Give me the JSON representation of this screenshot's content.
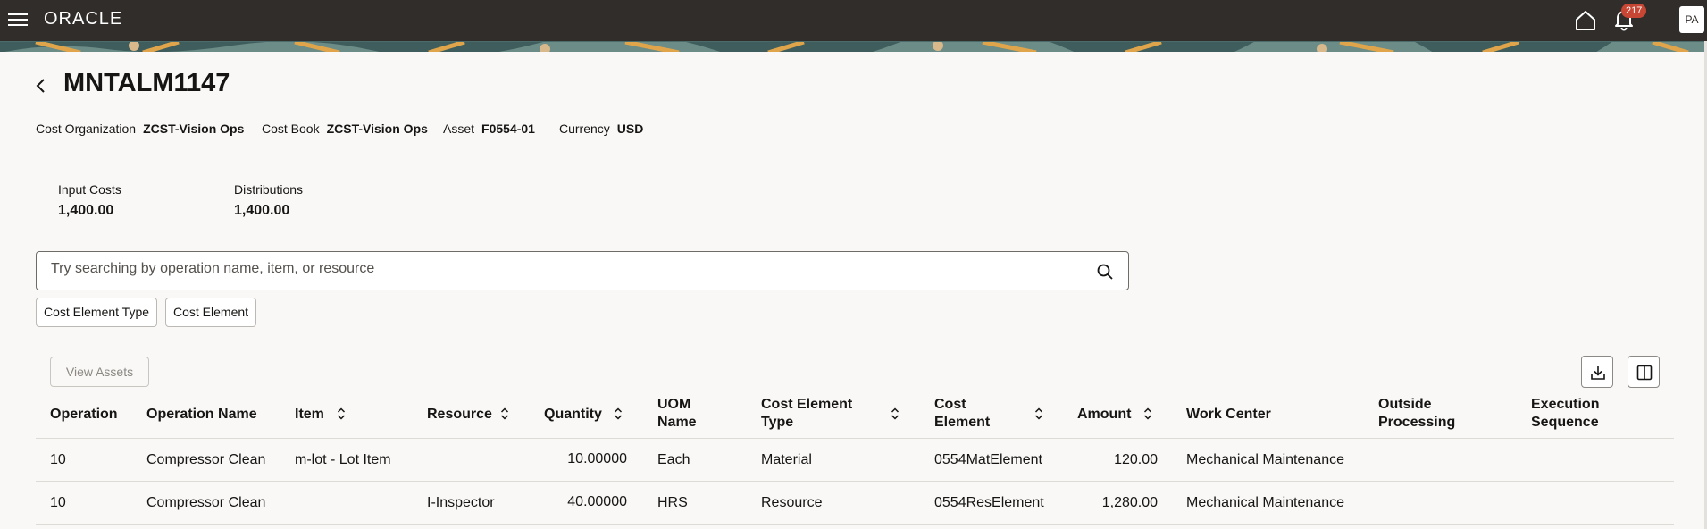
{
  "topbar": {
    "logo": "ORACLE",
    "notification_count": "217",
    "avatar_initials": "PA"
  },
  "header": {
    "title": "MNTALM1147",
    "meta": [
      {
        "label": "Cost Organization",
        "value": "ZCST-Vision Ops"
      },
      {
        "label": "Cost Book",
        "value": "ZCST-Vision Ops"
      },
      {
        "label": "Asset",
        "value": "F0554-01"
      },
      {
        "label": "Currency",
        "value": "USD"
      }
    ]
  },
  "metrics": [
    {
      "label": "Input Costs",
      "value": "1,400.00"
    },
    {
      "label": "Distributions",
      "value": "1,400.00"
    }
  ],
  "search": {
    "placeholder": "Try searching by operation name, item, or resource",
    "value": ""
  },
  "filters": [
    "Cost Element Type",
    "Cost Element"
  ],
  "toolbar": {
    "view_assets_label": "View Assets"
  },
  "table": {
    "columns": {
      "operation": "Operation",
      "operation_name": "Operation Name",
      "item": "Item",
      "resource": "Resource",
      "quantity": "Quantity",
      "uom_name_1": "UOM",
      "uom_name_2": "Name",
      "cost_element_type_1": "Cost Element",
      "cost_element_type_2": "Type",
      "cost_element_1": "Cost",
      "cost_element_2": "Element",
      "amount": "Amount",
      "work_center": "Work Center",
      "outside_processing_1": "Outside",
      "outside_processing_2": "Processing",
      "execution_sequence_1": "Execution",
      "execution_sequence_2": "Sequence"
    },
    "rows": [
      {
        "operation": "10",
        "operation_name": "Compressor Clean",
        "item": "m-lot - Lot Item",
        "resource": "",
        "quantity": "10.00000",
        "uom": "Each",
        "cost_element_type": "Material",
        "cost_element": "0554MatElement",
        "amount": "120.00",
        "work_center": "Mechanical Maintenance",
        "outside_processing": "",
        "execution_sequence": ""
      },
      {
        "operation": "10",
        "operation_name": "Compressor Clean",
        "item": "",
        "resource": "I-Inspector",
        "quantity": "40.00000",
        "uom": "HRS",
        "cost_element_type": "Resource",
        "cost_element": "0554ResElement",
        "amount": "1,280.00",
        "work_center": "Mechanical Maintenance",
        "outside_processing": "",
        "execution_sequence": ""
      }
    ]
  },
  "colors": {
    "topbar": "#312d2a",
    "badge": "#c74634",
    "page_bg": "#f9f8f6"
  }
}
